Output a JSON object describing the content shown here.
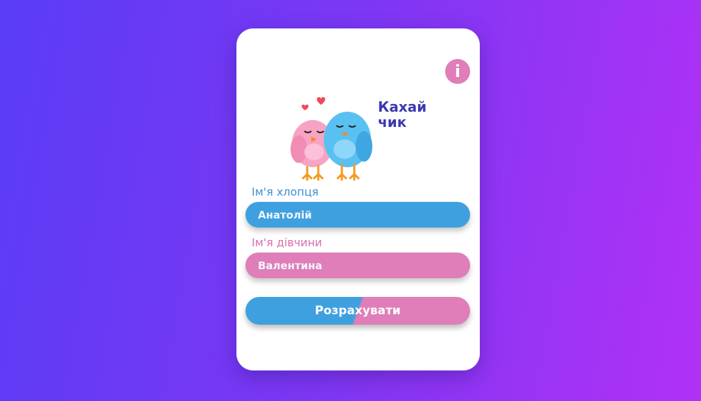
{
  "app": {
    "brand_title": "Кахайчик",
    "info_label": "i"
  },
  "form": {
    "boy_label": "Ім'я хлопця",
    "boy_value": "Анатолій",
    "girl_label": "Ім'я дівчини",
    "girl_value": "Валентина",
    "submit_label": "Розрахувати"
  },
  "colors": {
    "background_from": "#5a3cf6",
    "background_to": "#b131f6",
    "boy_accent": "#3fa0e0",
    "girl_accent": "#df7eb8",
    "brand_text": "#3b3ab0"
  },
  "icons": {
    "info": "info-icon",
    "logo": "lovebirds-logo-icon"
  }
}
